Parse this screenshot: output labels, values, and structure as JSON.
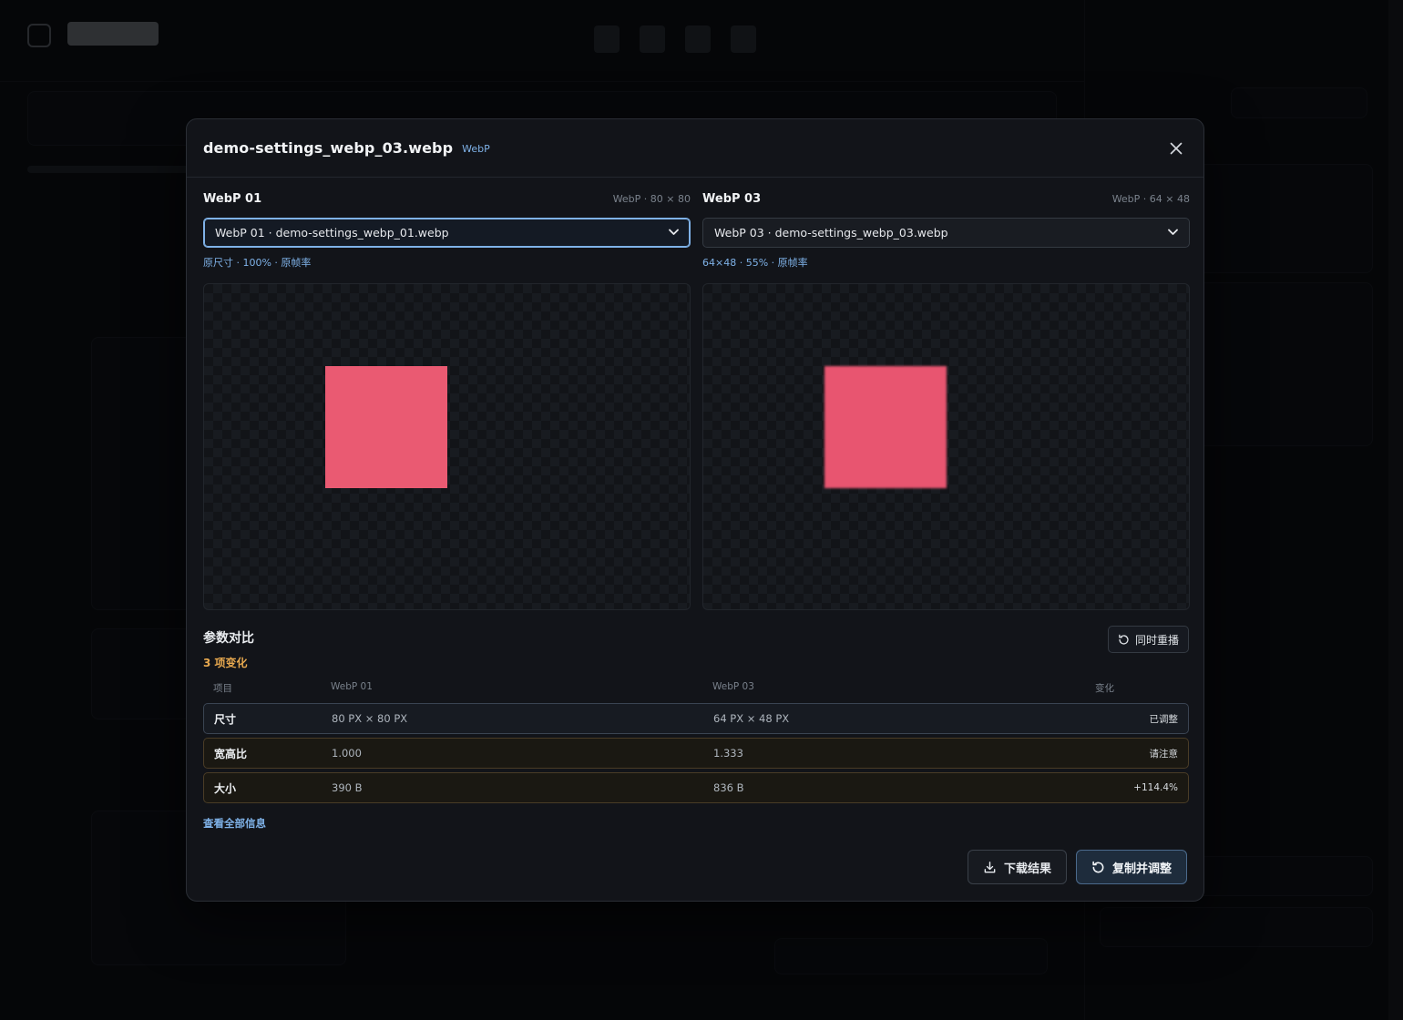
{
  "modal": {
    "title": "demo-settings_webp_03.webp",
    "format_badge": "WebP",
    "close_glyph": "✕"
  },
  "left_pane": {
    "label": "WebP 01",
    "meta": "WebP · 80 × 80",
    "select_value": "WebP 01 · demo-settings_webp_01.webp",
    "sub": "原尺寸 · 100% · 原帧率",
    "sprite_color": "#ea5a72"
  },
  "right_pane": {
    "label": "WebP 03",
    "meta": "WebP · 64 × 48",
    "select_value": "WebP 03 · demo-settings_webp_03.webp",
    "sub": "64×48 · 55% · 原帧率",
    "sprite_color": "#e85570"
  },
  "params": {
    "title": "参数对比",
    "changes": "3 项变化",
    "replay_label": "同时重播",
    "headers": {
      "item": "项目",
      "a": "WebP 01",
      "b": "WebP 03",
      "change": "变化"
    },
    "rows": [
      {
        "item": "尺寸",
        "a": "80 PX × 80 PX",
        "b": "64 PX × 48 PX",
        "change": "已调整"
      },
      {
        "item": "宽高比",
        "a": "1.000",
        "b": "1.333",
        "change": "请注意"
      },
      {
        "item": "大小",
        "a": "390 B",
        "b": "836 B",
        "change": "+114.4%"
      }
    ],
    "view_all": "查看全部信息"
  },
  "footer": {
    "download_label": "下载结果",
    "copy_adjust_label": "复制并调整"
  },
  "colors": {
    "accent": "#7fb2e8",
    "warning": "#e8a94f",
    "modal_bg": "#121419"
  }
}
